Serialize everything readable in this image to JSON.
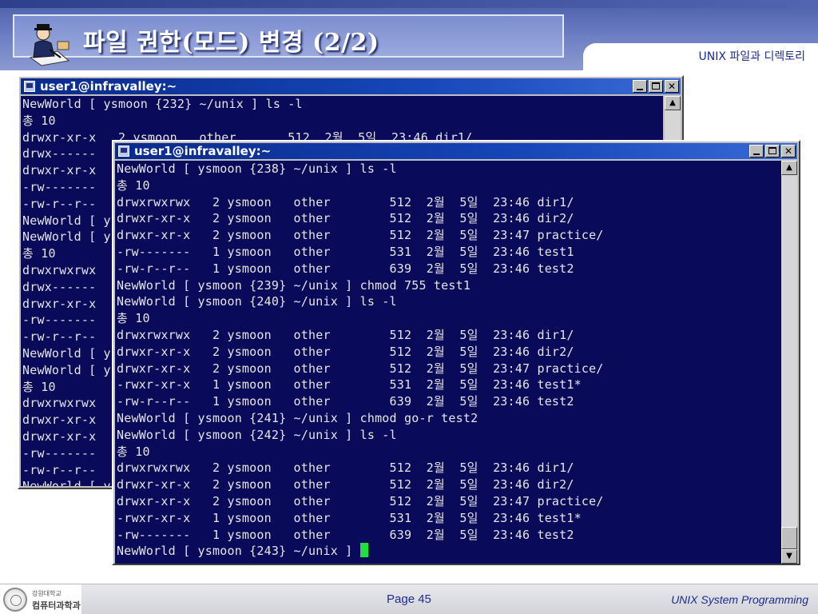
{
  "header": {
    "title": "파일 권한(모드) 변경 (2/2)",
    "section": "UNIX 파일과 디렉토리"
  },
  "back_window": {
    "title": "user1@infravalley:~",
    "lines": [
      "NewWorld [ ysmoon {232} ~/unix ] ls -l",
      "총 10",
      "drwxr-xr-x   2 ysmoon   other       512  2월  5일  23:46 dir1/",
      "drwx------",
      "drwxr-xr-x",
      "-rw-------",
      "-rw-r--r--",
      "NewWorld [ y",
      "NewWorld [ y",
      "총 10",
      "drwxrwxrwx",
      "drwx------",
      "drwxr-xr-x",
      "-rw-------",
      "-rw-r--r--",
      "NewWorld [ y",
      "NewWorld [ y",
      "총 10",
      "drwxrwxrwx",
      "drwxr-xr-x",
      "drwxr-xr-x",
      "-rw-------",
      "-rw-r--r--",
      "NewWorld [ y"
    ]
  },
  "front_window": {
    "title": "user1@infravalley:~",
    "lines": [
      "NewWorld [ ysmoon {238} ~/unix ] ls -l",
      "총 10",
      "drwxrwxrwx   2 ysmoon   other        512  2월  5일  23:46 dir1/",
      "drwxr-xr-x   2 ysmoon   other        512  2월  5일  23:46 dir2/",
      "drwxr-xr-x   2 ysmoon   other        512  2월  5일  23:47 practice/",
      "-rw-------   1 ysmoon   other        531  2월  5일  23:46 test1",
      "-rw-r--r--   1 ysmoon   other        639  2월  5일  23:46 test2",
      "NewWorld [ ysmoon {239} ~/unix ] chmod 755 test1",
      "NewWorld [ ysmoon {240} ~/unix ] ls -l",
      "총 10",
      "drwxrwxrwx   2 ysmoon   other        512  2월  5일  23:46 dir1/",
      "drwxr-xr-x   2 ysmoon   other        512  2월  5일  23:46 dir2/",
      "drwxr-xr-x   2 ysmoon   other        512  2월  5일  23:47 practice/",
      "-rwxr-xr-x   1 ysmoon   other        531  2월  5일  23:46 test1*",
      "-rw-r--r--   1 ysmoon   other        639  2월  5일  23:46 test2",
      "NewWorld [ ysmoon {241} ~/unix ] chmod go-r test2",
      "NewWorld [ ysmoon {242} ~/unix ] ls -l",
      "총 10",
      "drwxrwxrwx   2 ysmoon   other        512  2월  5일  23:46 dir1/",
      "drwxr-xr-x   2 ysmoon   other        512  2월  5일  23:46 dir2/",
      "drwxr-xr-x   2 ysmoon   other        512  2월  5일  23:47 practice/",
      "-rwxr-xr-x   1 ysmoon   other        531  2월  5일  23:46 test1*",
      "-rw-------   1 ysmoon   other        639  2월  5일  23:46 test2"
    ],
    "prompt": "NewWorld [ ysmoon {243} ~/unix ] "
  },
  "footer": {
    "university_small": "강원대학교",
    "department": "컴퓨터과학과",
    "page": "Page 45",
    "course": "UNIX System Programming"
  },
  "colors": {
    "terminal_bg": "#0a0a5a",
    "terminal_fg": "#e6e6e6",
    "cursor": "#22e040",
    "titlebar": "#0a2a8c",
    "accent": "#1c2c8c"
  }
}
